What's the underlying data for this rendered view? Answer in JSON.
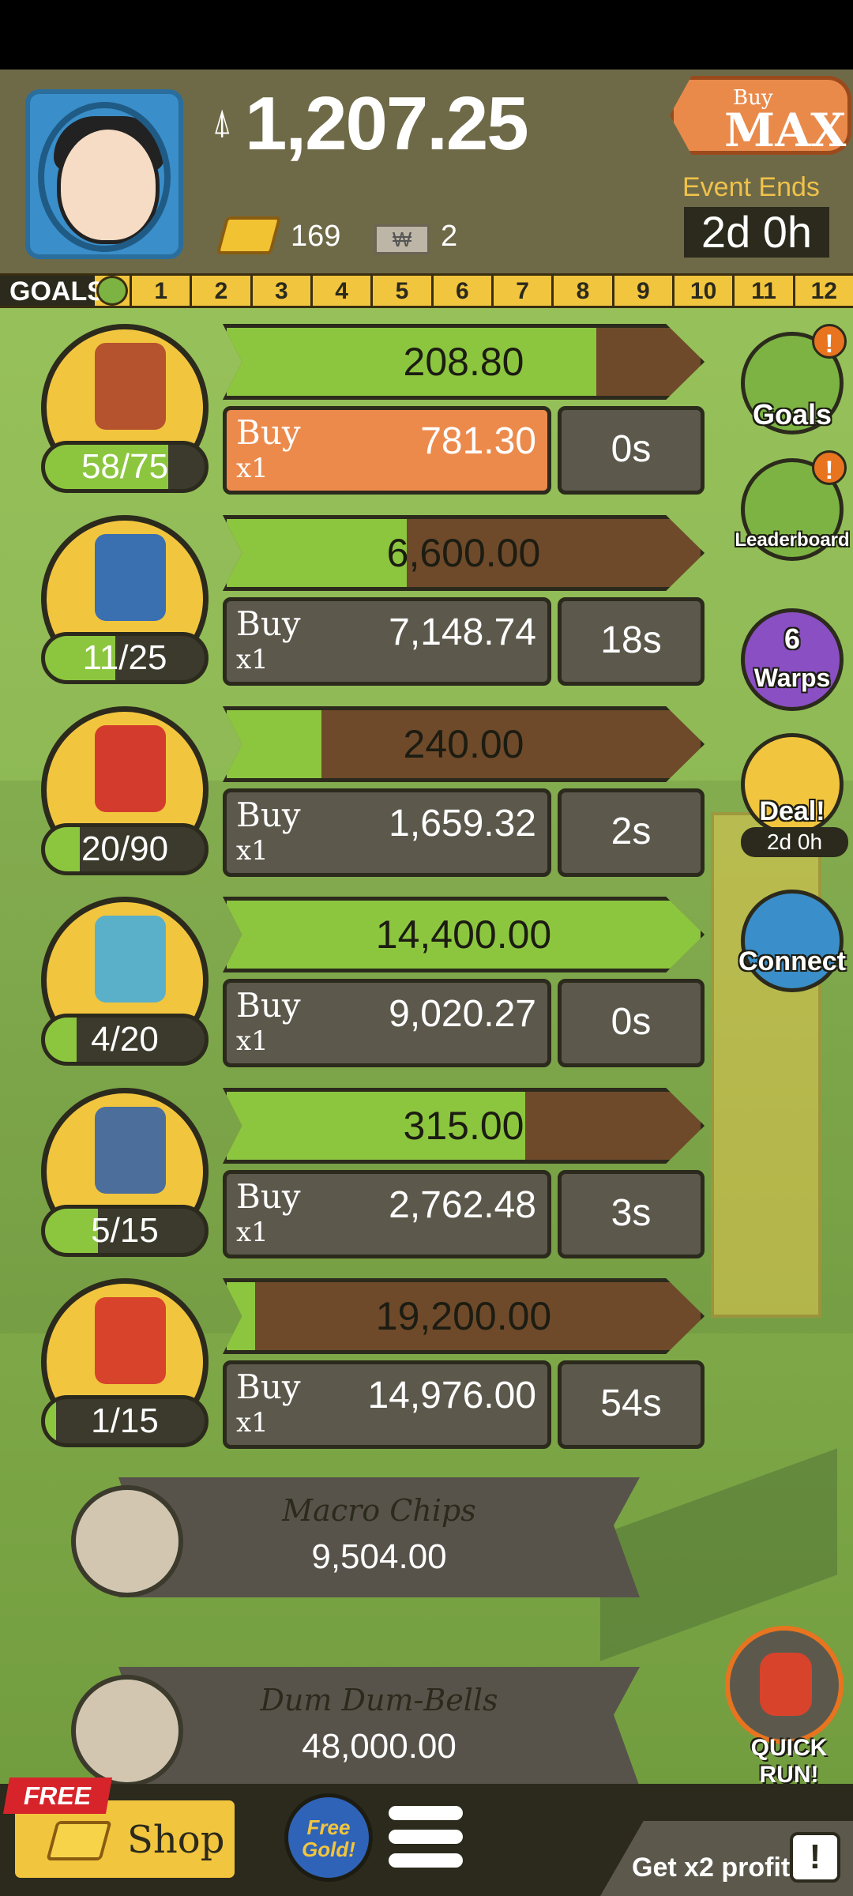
{
  "header": {
    "money": "1,207.25",
    "gold": "169",
    "megabucks": "2",
    "megabucks_symbol": "₩",
    "buy_max": {
      "top": "Buy",
      "bottom": "MAX"
    },
    "event_label": "Event Ends in:",
    "event_time": "2d 0h"
  },
  "goals": {
    "label": "GOALS",
    "numbers": [
      "1",
      "2",
      "3",
      "4",
      "5",
      "6",
      "7",
      "8",
      "9",
      "10",
      "11",
      "12"
    ]
  },
  "businesses": [
    {
      "name": "armchair",
      "count": "58/75",
      "count_frac": 0.77,
      "bar_value": "208.80",
      "bar_frac": 0.78,
      "buy_label": "Buy",
      "mult": "x1",
      "cost": "781.30",
      "timer": "0s",
      "affordable": true,
      "icon_color": "#b5532f"
    },
    {
      "name": "treadmill",
      "count": "11/25",
      "count_frac": 0.44,
      "bar_value": "6,600.00",
      "bar_frac": 0.38,
      "buy_label": "Buy",
      "mult": "x1",
      "cost": "7,148.74",
      "timer": "18s",
      "affordable": false,
      "icon_color": "#3a6fb0"
    },
    {
      "name": "soda-can",
      "count": "20/90",
      "count_frac": 0.22,
      "bar_value": "240.00",
      "bar_frac": 0.2,
      "buy_label": "Buy",
      "mult": "x1",
      "cost": "1,659.32",
      "timer": "2s",
      "affordable": false,
      "icon_color": "#d33c2c"
    },
    {
      "name": "smoothie-cup",
      "count": "4/20",
      "count_frac": 0.2,
      "bar_value": "14,400.00",
      "bar_frac": 1.0,
      "buy_label": "Buy",
      "mult": "x1",
      "cost": "9,020.27",
      "timer": "0s",
      "affordable": false,
      "icon_color": "#5bb0c9"
    },
    {
      "name": "game-console",
      "count": "5/15",
      "count_frac": 0.33,
      "bar_value": "315.00",
      "bar_frac": 0.63,
      "buy_label": "Buy",
      "mult": "x1",
      "cost": "2,762.48",
      "timer": "3s",
      "affordable": false,
      "icon_color": "#4b6f9a"
    },
    {
      "name": "boxing-glove",
      "count": "1/15",
      "count_frac": 0.07,
      "bar_value": "19,200.00",
      "bar_frac": 0.06,
      "buy_label": "Buy",
      "mult": "x1",
      "cost": "14,976.00",
      "timer": "54s",
      "affordable": false,
      "icon_color": "#d8432c"
    }
  ],
  "locked": [
    {
      "name": "Macro Chips",
      "value": "9,504.00"
    },
    {
      "name": "Dum Dum-Bells",
      "value": "48,000.00"
    }
  ],
  "side_buttons": {
    "goals": "Goals",
    "leaderboard": "Leaderboard",
    "warps": "Warps",
    "warps_count": "6",
    "deal": "Deal!",
    "deal_time": "2d 0h",
    "connect": "Connect",
    "alert": "!"
  },
  "quick_run": "QUICK RUN!",
  "bottom": {
    "free": "FREE",
    "shop": "Shop",
    "free_gold": "Free Gold!",
    "x2_profit": "Get x2 profit!",
    "tv_alert": "!"
  },
  "colors": {
    "accent": "#8cc63f",
    "gold": "#f2c53e",
    "dark": "#2b2a1c",
    "orange": "#ec8a4c"
  }
}
